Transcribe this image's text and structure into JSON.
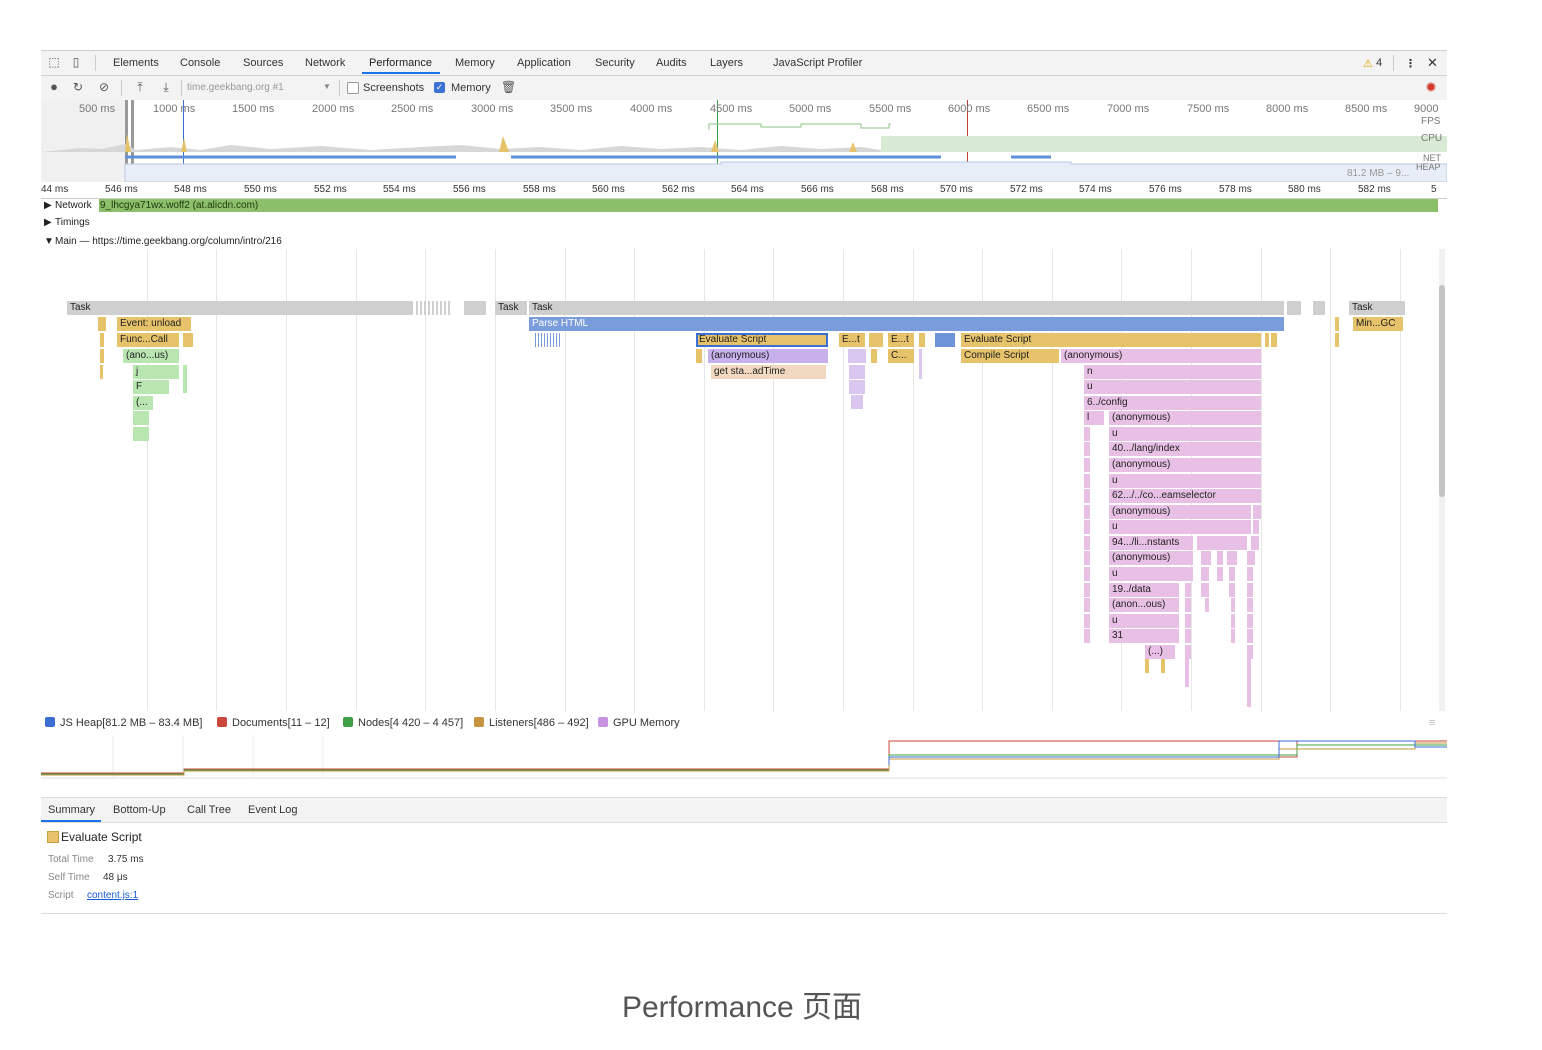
{
  "tabs": [
    "Elements",
    "Console",
    "Sources",
    "Network",
    "Performance",
    "Memory",
    "Application",
    "Security",
    "Audits",
    "Layers",
    "JavaScript Profiler"
  ],
  "warning_count": "4",
  "toolbar": {
    "record_icon": "record-icon",
    "reload_icon": "reload-icon",
    "clear_icon": "clear-icon",
    "upload_icon": "upload-icon",
    "download_icon": "download-icon",
    "profile_select": "time.geekbang.org #1",
    "screenshots_label": "Screenshots",
    "screenshots_checked": false,
    "memory_label": "Memory",
    "memory_checked": true,
    "trash_icon": "trash-icon",
    "settings_icon": "gear-icon"
  },
  "overview": {
    "ticks": [
      "500 ms",
      "1000 ms",
      "1500 ms",
      "2000 ms",
      "2500 ms",
      "3000 ms",
      "3500 ms",
      "4000 ms",
      "4500 ms",
      "5000 ms",
      "5500 ms",
      "6000 ms",
      "6500 ms",
      "7000 ms",
      "7500 ms",
      "8000 ms",
      "8500 ms",
      "9000"
    ],
    "labels": {
      "fps": "FPS",
      "cpu": "CPU",
      "net": "NET",
      "heap": "HEAP",
      "heap_range": "81.2 MB – 9..."
    }
  },
  "ruler": [
    "44 ms",
    "546 ms",
    "548 ms",
    "550 ms",
    "552 ms",
    "554 ms",
    "556 ms",
    "558 ms",
    "560 ms",
    "562 ms",
    "564 ms",
    "566 ms",
    "568 ms",
    "570 ms",
    "572 ms",
    "574 ms",
    "576 ms",
    "578 ms",
    "580 ms",
    "582 ms",
    "5"
  ],
  "tracks": {
    "network_label": "Network",
    "network_item": "9_lhcgya71wx.woff2 (at.alicdn.com)",
    "timings_label": "Timings",
    "main_label": "Main — https://time.geekbang.org/column/intro/216"
  },
  "flame": [
    {
      "t": "Task",
      "kind": "task"
    },
    {
      "t": "Task",
      "kind": "task"
    },
    {
      "t": "Task",
      "kind": "task"
    },
    {
      "t": "Task",
      "kind": "task"
    },
    {
      "t": "Event: unload",
      "kind": "yellow"
    },
    {
      "t": "Parse HTML",
      "kind": "blue"
    },
    {
      "t": "Min...GC",
      "kind": "yellow"
    },
    {
      "t": "Func...Call",
      "kind": "yellow"
    },
    {
      "t": "Evaluate Script",
      "kind": "yellow"
    },
    {
      "t": "E...t",
      "kind": "yellow"
    },
    {
      "t": "E...t",
      "kind": "yellow"
    },
    {
      "t": "Evaluate Script",
      "kind": "yellow"
    },
    {
      "t": "(ano...us)",
      "kind": "green"
    },
    {
      "t": "(anonymous)",
      "kind": "purple"
    },
    {
      "t": "C...",
      "kind": "yellow"
    },
    {
      "t": "Compile Script",
      "kind": "yellow"
    },
    {
      "t": "(anonymous)",
      "kind": "pink"
    },
    {
      "t": "j",
      "kind": "green"
    },
    {
      "t": "get sta...adTime",
      "kind": "tan"
    },
    {
      "t": "n",
      "kind": "pink"
    },
    {
      "t": "F",
      "kind": "green"
    },
    {
      "t": "u",
      "kind": "pink"
    },
    {
      "t": "(...",
      "kind": "green"
    },
    {
      "t": "6../config",
      "kind": "pink"
    },
    {
      "t": "l",
      "kind": "pink"
    },
    {
      "t": "(anonymous)",
      "kind": "pink"
    },
    {
      "t": "u",
      "kind": "pink"
    },
    {
      "t": "40.../lang/index",
      "kind": "pink"
    },
    {
      "t": "(anonymous)",
      "kind": "pink"
    },
    {
      "t": "u",
      "kind": "pink"
    },
    {
      "t": "62.../../co...eamselector",
      "kind": "pink"
    },
    {
      "t": "(anonymous)",
      "kind": "pink"
    },
    {
      "t": "u",
      "kind": "pink"
    },
    {
      "t": "94.../li...nstants",
      "kind": "pink"
    },
    {
      "t": "(anonymous)",
      "kind": "pink"
    },
    {
      "t": "u",
      "kind": "pink"
    },
    {
      "t": "19../data",
      "kind": "pink"
    },
    {
      "t": "(anon...ous)",
      "kind": "pink"
    },
    {
      "t": "u",
      "kind": "pink"
    },
    {
      "t": "31",
      "kind": "pink"
    },
    {
      "t": "(...)",
      "kind": "pink"
    }
  ],
  "legend": [
    {
      "label": "JS Heap[81.2 MB – 83.4 MB]",
      "color": "#3b6fd4",
      "checked": true
    },
    {
      "label": "Documents[11 – 12]",
      "color": "#c9473d",
      "checked": true
    },
    {
      "label": "Nodes[4 420 – 4 457]",
      "color": "#3fa046",
      "checked": true
    },
    {
      "label": "Listeners[486 – 492]",
      "color": "#c7953f",
      "checked": true
    },
    {
      "label": "GPU Memory",
      "color": "#c792e0",
      "checked": false
    }
  ],
  "bottom_tabs": [
    "Summary",
    "Bottom-Up",
    "Call Tree",
    "Event Log"
  ],
  "summary": {
    "title": "Evaluate Script",
    "title_color": "#e6c36a",
    "total_label": "Total Time",
    "total_value": "3.75 ms",
    "self_label": "Self Time",
    "self_value": "48 μs",
    "script_label": "Script",
    "script_link": "content.js:1"
  },
  "caption": "Performance 页面"
}
